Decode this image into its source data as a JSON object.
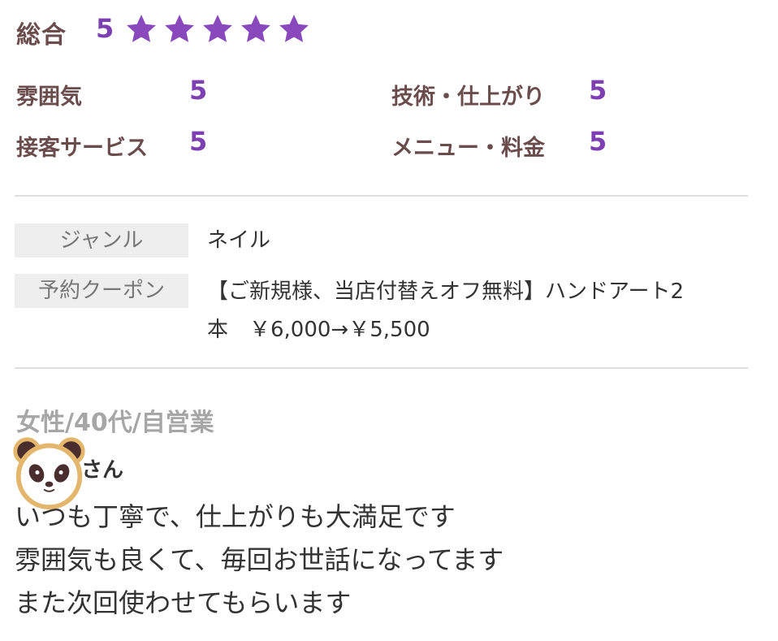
{
  "overall": {
    "label": "総合",
    "score": "5",
    "stars_filled": 5,
    "stars_total": 5,
    "star_color": "#8a48bd"
  },
  "categories": [
    {
      "label": "雰囲気",
      "score": "5"
    },
    {
      "label": "技術・仕上がり",
      "score": "5"
    },
    {
      "label": "接客サービス",
      "score": "5"
    },
    {
      "label": "メニュー・料金",
      "score": "5"
    }
  ],
  "details": {
    "genre_label": "ジャンル",
    "genre_value": "ネイル",
    "coupon_label": "予約クーポン",
    "coupon_line1": "【ご新規様、当店付替えオフ無料】ハンドアート2",
    "coupon_line2": "本　￥6,000→￥5,500"
  },
  "reviewer": {
    "meta": "女性/40代/自営業",
    "name_suffix": "さん",
    "avatar_icon": "panda-icon"
  },
  "review": {
    "lines": [
      "いつも丁寧で、仕上がりも大満足です",
      "雰囲気も良くて、毎回お世話になってます",
      "また次回使わせてもらいます"
    ]
  },
  "colors": {
    "accent": "#7e3fb3",
    "label_brown": "#6b4c4c",
    "tag_bg": "#eeeeee",
    "divider": "#dedede"
  }
}
